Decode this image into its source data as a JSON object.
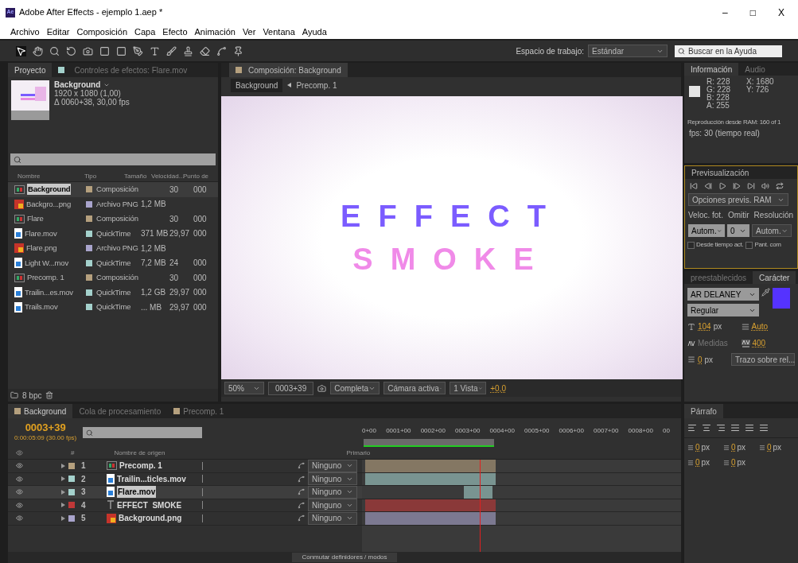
{
  "window": {
    "badge": "Ae",
    "title": "Adobe After Effects - ejemplo 1.aep *",
    "controls": [
      "–",
      "□",
      "X"
    ]
  },
  "menu": [
    "Archivo",
    "Editar",
    "Composición",
    "Capa",
    "Efecto",
    "Animación",
    "Ver",
    "Ventana",
    "Ayuda"
  ],
  "toolbar": {
    "workspace_label": "Espacio de trabajo:",
    "workspace": "Estándar",
    "help_placeholder": "Buscar en la Ayuda"
  },
  "project_panel": {
    "tabs": [
      {
        "label": "Proyecto",
        "selected": true
      },
      {
        "label": "Controles de efectos: Flare.mov",
        "selected": false
      }
    ],
    "preview": {
      "name": "Background",
      "dims": "1920 x 1080 (1,00)",
      "duration": "Δ 0060+38, 30,00 fps"
    },
    "columns": [
      "Nombre",
      "Tipo",
      "Tamaño",
      "Velocidad...",
      "Punto de"
    ],
    "items": [
      {
        "name": "Background",
        "kind": "comp",
        "color": "#b5a07e",
        "type": "Composición",
        "rate": "30",
        "start": "000",
        "selected": true
      },
      {
        "name": "Backgro...png",
        "kind": "image",
        "color": "#a9a4cc",
        "type": "Archivo PNG",
        "size": "1,2 MB",
        "selected": false
      },
      {
        "name": "Flare",
        "kind": "comp",
        "color": "#b5a07e",
        "type": "Composición",
        "rate": "30",
        "start": "000",
        "selected": false
      },
      {
        "name": "Flare.mov",
        "kind": "movie",
        "color": "#a4d1cc",
        "type": "QuickTime",
        "size": "371 MB",
        "rate": "29,97",
        "start": "000",
        "selected": false
      },
      {
        "name": "Flare.png",
        "kind": "image",
        "color": "#a9a4cc",
        "type": "Archivo PNG",
        "size": "1,2 MB",
        "selected": false
      },
      {
        "name": "Light W...mov",
        "kind": "movie",
        "color": "#a4d1cc",
        "type": "QuickTime",
        "size": "7,2 MB",
        "rate": "24",
        "start": "000",
        "selected": false
      },
      {
        "name": "Precomp. 1",
        "kind": "comp",
        "color": "#b5a07e",
        "type": "Composición",
        "rate": "30",
        "start": "000",
        "selected": false
      },
      {
        "name": "Trailin...es.mov",
        "kind": "movie",
        "color": "#a4d1cc",
        "type": "QuickTime",
        "size": "1,2 GB",
        "rate": "29,97",
        "start": "000",
        "selected": false
      },
      {
        "name": "Trails.mov",
        "kind": "movie",
        "color": "#a4d1cc",
        "type": "QuickTime",
        "size": "... MB",
        "rate": "29,97",
        "start": "000",
        "selected": false
      }
    ],
    "bpc": "8 bpc"
  },
  "composition": {
    "tab": "Composición: Background",
    "breadcrumb": [
      "Background",
      "Precomp. 1"
    ],
    "lines": [
      {
        "text": "EFFECT",
        "color": "#7b5cff"
      },
      {
        "text": "SMOKE",
        "color": "#f08ae8"
      }
    ],
    "zoom": "50%",
    "time": "0003+39",
    "resolution": "Completa",
    "camera": "Cámara activa",
    "views": "1 Vista",
    "exposure": "+0,0"
  },
  "info_panel": {
    "tabs": [
      {
        "label": "Información",
        "selected": true
      },
      {
        "label": "Audio",
        "selected": false
      }
    ],
    "color_values": [
      "R: 228",
      "G: 228",
      "B: 228",
      "A: 255"
    ],
    "sample": {
      "color": "#e4e4e4"
    },
    "position": [
      "X: 1680",
      "Y: 726"
    ],
    "message": "Reproducción desde RAM: 160 of 1",
    "fps": "fps: 30 (tiempo real)"
  },
  "preview_panel": {
    "tab": "Previsualización",
    "options": "Opciones previs. RAM",
    "labels": [
      "Veloc. fot.",
      "Omitir",
      "Resolución"
    ],
    "frame_rate": "Autom.",
    "skip": "0",
    "resolution": "Autom.",
    "checkboxes": [
      {
        "label": "Desde tiempo act.",
        "checked": false
      },
      {
        "label": "Pant. com",
        "checked": false
      }
    ]
  },
  "character_panel": {
    "tabs": [
      {
        "label": "preestablecidos",
        "selected": false
      },
      {
        "label": "Carácter",
        "selected": true
      }
    ],
    "font": "AR DELANEY",
    "style": "Regular",
    "fill": {
      "color": "#5533ff"
    },
    "size": "104",
    "size_unit": "px",
    "leading": "Auto",
    "kerning": "Medidas",
    "tracking": "400",
    "stroke": "0",
    "stroke_unit": "px",
    "stroke_mode": "Trazo sobre rel..."
  },
  "timeline": {
    "tabs": [
      {
        "label": "Background",
        "selected": true,
        "color": "#b5a07e"
      },
      {
        "label": "Cola de procesamiento",
        "selected": false
      },
      {
        "label": "Precomp. 1",
        "selected": false,
        "color": "#b5a07e"
      }
    ],
    "time": "0003+39",
    "time_detail": "0:00:05:09 (30.00 fps)",
    "columns": [
      "#",
      "Nombre de origen",
      "Primario"
    ],
    "ruler": [
      "0+00",
      "0001+00",
      "0002+00",
      "0003+00",
      "0004+00",
      "0005+00",
      "0006+00",
      "0007+00",
      "0008+00",
      "00"
    ],
    "playhead": {
      "level": 0.41
    },
    "layers": [
      {
        "number": "1",
        "name": "Precomp. 1",
        "kind": "comp",
        "color": "#b5a07e",
        "parent": "Ninguno",
        "selected": false
      },
      {
        "number": "2",
        "name": "Trailin...ticles.mov",
        "kind": "movie",
        "color": "#a4d1cc",
        "parent": "Ninguno",
        "selected": false
      },
      {
        "number": "3",
        "name": "Flare.mov",
        "kind": "movie",
        "color": "#a4d1cc",
        "parent": "Ninguno",
        "selected": true
      },
      {
        "number": "4",
        "name": "EFFECT  SMOKE",
        "kind": "text",
        "color": "#c03838",
        "parent": "Ninguno",
        "selected": false
      },
      {
        "number": "5",
        "name": "Background.png",
        "kind": "image",
        "color": "#a9a4cc",
        "parent": "Ninguno",
        "selected": false
      }
    ],
    "footer_button": "Conmutar definidores / modos"
  },
  "paragraph_panel": {
    "tab": "Párrafo",
    "fields": [
      {
        "value": "0",
        "unit": "px"
      },
      {
        "value": "0",
        "unit": "px"
      },
      {
        "value": "0",
        "unit": "px"
      },
      {
        "value": "0",
        "unit": "px"
      },
      {
        "value": "0",
        "unit": "px"
      }
    ]
  }
}
